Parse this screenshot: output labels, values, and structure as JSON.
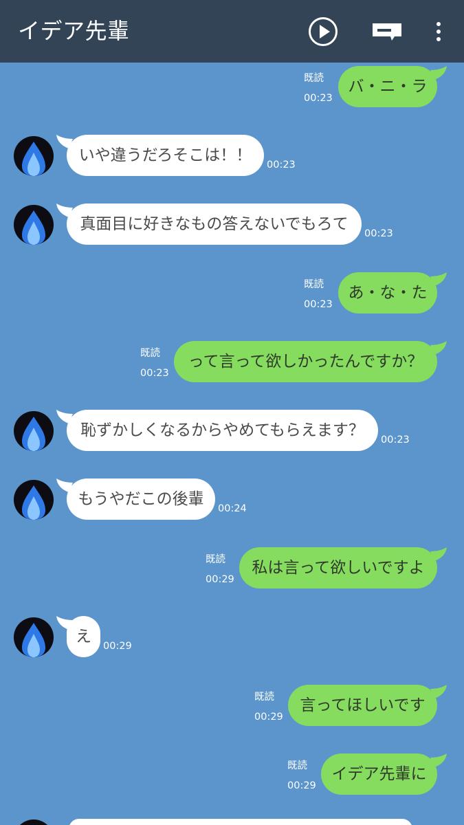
{
  "header": {
    "title": "イデア先輩",
    "icons": [
      "play-icon",
      "note-icon",
      "more-vertical-icon"
    ],
    "background": "#334456"
  },
  "colors": {
    "chat_background": "#5b95cc",
    "outgoing_bubble": "#86dc5f",
    "incoming_bubble": "#ffffff"
  },
  "messages": [
    {
      "side": "out",
      "text": "バ・ニ・ラ",
      "read": "既読",
      "time": "00:23"
    },
    {
      "side": "in",
      "text": "いや違うだろそこは！！",
      "time": "00:23"
    },
    {
      "side": "in",
      "text": "真面目に好きなもの答えないでもろて",
      "time": "00:23"
    },
    {
      "side": "out",
      "text": "あ・な・た",
      "read": "既読",
      "time": "00:23"
    },
    {
      "side": "out",
      "text": "って言って欲しかったんですか？",
      "read": "既読",
      "time": "00:23"
    },
    {
      "side": "in",
      "text": "恥ずかしくなるからやめてもらえます？",
      "time": "00:23"
    },
    {
      "side": "in",
      "text": "もうやだこの後輩",
      "time": "00:24"
    },
    {
      "side": "out",
      "text": "私は言って欲しいですよ",
      "read": "既読",
      "time": "00:29"
    },
    {
      "side": "in",
      "text": "え",
      "time": "00:29"
    },
    {
      "side": "out",
      "text": "言ってほしいです",
      "read": "既読",
      "time": "00:29"
    },
    {
      "side": "out",
      "text": "イデア先輩に",
      "read": "既読",
      "time": "00:29"
    }
  ]
}
